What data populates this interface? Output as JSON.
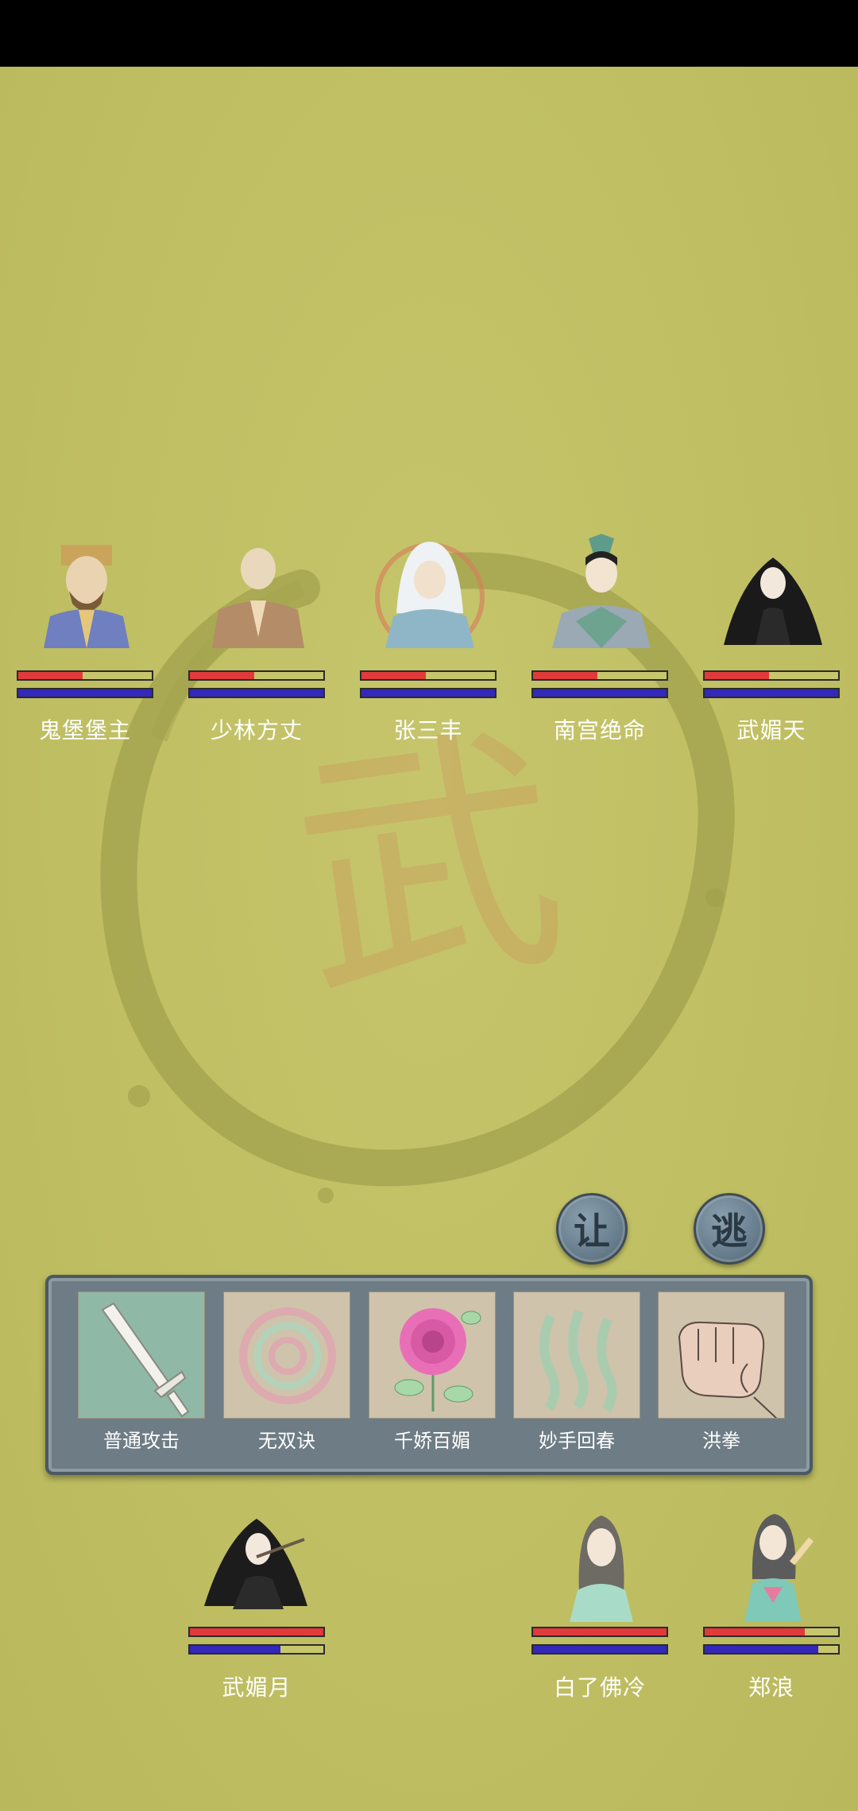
{
  "enemies": [
    {
      "name": "鬼堡堡主",
      "hp": 0.48,
      "mp": 1.0
    },
    {
      "name": "少林方丈",
      "hp": 0.48,
      "mp": 1.0
    },
    {
      "name": "张三丰",
      "hp": 0.48,
      "mp": 1.0
    },
    {
      "name": "南宫绝命",
      "hp": 0.48,
      "mp": 1.0
    },
    {
      "name": "武媚天",
      "hp": 0.48,
      "mp": 1.0
    }
  ],
  "allies": [
    {
      "name": "武媚月",
      "hp": 1.0,
      "mp": 0.68
    },
    {
      "name": "白了佛冷",
      "hp": 1.0,
      "mp": 1.0
    },
    {
      "name": "郑浪",
      "hp": 0.75,
      "mp": 0.85
    }
  ],
  "actions": {
    "yield_label": "让",
    "flee_label": "逃"
  },
  "skills": [
    {
      "label": "普通攻击",
      "icon": "sword-icon",
      "selected": true
    },
    {
      "label": "无双诀",
      "icon": "spiral-icon",
      "selected": false
    },
    {
      "label": "千娇百媚",
      "icon": "rose-icon",
      "selected": false
    },
    {
      "label": "妙手回春",
      "icon": "healing-wave-icon",
      "selected": false
    },
    {
      "label": "洪拳",
      "icon": "fist-icon",
      "selected": false
    }
  ],
  "colors": {
    "background": "#c2c066",
    "hp_bar": "#e03a3a",
    "mp_bar": "#3328b8",
    "panel": "#6e7c85"
  }
}
